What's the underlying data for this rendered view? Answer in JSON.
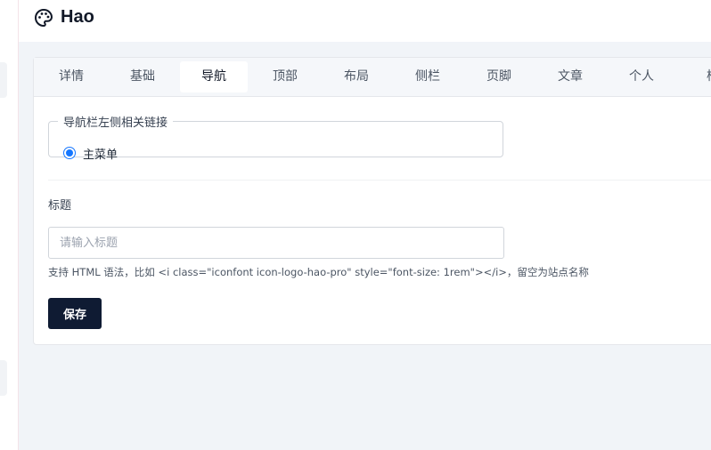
{
  "header": {
    "title": "Hao",
    "logo_icon": "palette-icon"
  },
  "tabs": [
    {
      "label": "详情",
      "active": false
    },
    {
      "label": "基础",
      "active": false
    },
    {
      "label": "导航",
      "active": true
    },
    {
      "label": "顶部",
      "active": false
    },
    {
      "label": "布局",
      "active": false
    },
    {
      "label": "侧栏",
      "active": false
    },
    {
      "label": "页脚",
      "active": false
    },
    {
      "label": "文章",
      "active": false
    },
    {
      "label": "个人",
      "active": false
    },
    {
      "label": "样",
      "active": false
    }
  ],
  "nav_group": {
    "legend": "导航栏左侧相关链接",
    "options": [
      {
        "label": "主菜单",
        "checked": true
      }
    ]
  },
  "title_field": {
    "label": "标题",
    "value": "",
    "placeholder": "请输入标题",
    "help": "支持 HTML 语法，比如 <i class=\"iconfont icon-logo-hao-pro\" style=\"font-size: 1rem\"></i>，留空为站点名称"
  },
  "save_button": {
    "label": "保存"
  },
  "colors": {
    "accent": "#1677ff",
    "primary_button": "#0f1b33",
    "content_bg": "#f1f4f8"
  }
}
